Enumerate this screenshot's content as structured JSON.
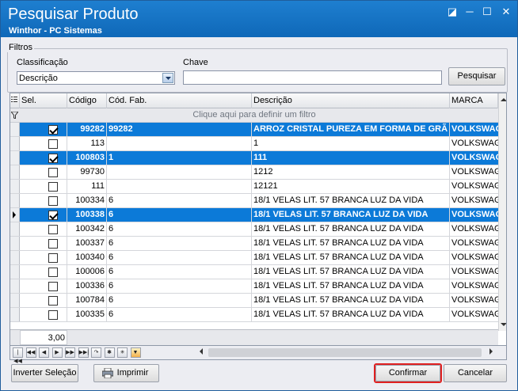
{
  "window": {
    "title": "Pesquisar Produto",
    "subtitle": "Winthor - PC Sistemas",
    "controls": {
      "help": "◪",
      "minimize": "─",
      "maximize": "☐",
      "close": "✕"
    }
  },
  "filters": {
    "group_label": "Filtros",
    "classificacao_label": "Classificação",
    "classificacao_value": "Descrição",
    "chave_label": "Chave",
    "chave_value": "",
    "search_button": "Pesquisar"
  },
  "grid": {
    "columns": [
      "Sel.",
      "Código",
      "Cód. Fab.",
      "Descrição",
      "MARCA"
    ],
    "filter_hint": "Clique aqui para definir um filtro",
    "rows": [
      {
        "selected": true,
        "checked": true,
        "codigo": "99282",
        "cod_fab": "99282",
        "descricao": "ARROZ  CRISTAL PUREZA EM FORMA DE GRÃ",
        "marca": "VOLKSWAG"
      },
      {
        "selected": false,
        "checked": false,
        "codigo": "113",
        "cod_fab": "",
        "descricao": "1",
        "marca": "VOLKSWAGI"
      },
      {
        "selected": true,
        "checked": true,
        "codigo": "100803",
        "cod_fab": "1",
        "descricao": "111",
        "marca": "VOLKSWAG"
      },
      {
        "selected": false,
        "checked": false,
        "codigo": "99730",
        "cod_fab": "",
        "descricao": "1212",
        "marca": "VOLKSWAGI"
      },
      {
        "selected": false,
        "checked": false,
        "codigo": "111",
        "cod_fab": "",
        "descricao": "12121",
        "marca": "VOLKSWAGI"
      },
      {
        "selected": false,
        "checked": false,
        "codigo": "100334",
        "cod_fab": "6",
        "descricao": "18/1 VELAS LIT. 57 BRANCA LUZ DA VIDA",
        "marca": "VOLKSWAGI"
      },
      {
        "selected": true,
        "checked": true,
        "current": true,
        "codigo": "100338",
        "cod_fab": "6",
        "descricao": "18/1 VELAS LIT. 57 BRANCA LUZ DA VIDA",
        "marca": "VOLKSWAG"
      },
      {
        "selected": false,
        "checked": false,
        "codigo": "100342",
        "cod_fab": "6",
        "descricao": "18/1 VELAS LIT. 57 BRANCA LUZ DA VIDA",
        "marca": "VOLKSWAGI"
      },
      {
        "selected": false,
        "checked": false,
        "codigo": "100337",
        "cod_fab": "6",
        "descricao": "18/1 VELAS LIT. 57 BRANCA LUZ DA VIDA",
        "marca": "VOLKSWAGI"
      },
      {
        "selected": false,
        "checked": false,
        "codigo": "100340",
        "cod_fab": "6",
        "descricao": "18/1 VELAS LIT. 57 BRANCA LUZ DA VIDA",
        "marca": "VOLKSWAGI"
      },
      {
        "selected": false,
        "checked": false,
        "codigo": "100006",
        "cod_fab": "6",
        "descricao": "18/1 VELAS LIT. 57 BRANCA LUZ DA VIDA",
        "marca": "VOLKSWAGI"
      },
      {
        "selected": false,
        "checked": false,
        "codigo": "100336",
        "cod_fab": "6",
        "descricao": "18/1 VELAS LIT. 57 BRANCA LUZ DA VIDA",
        "marca": "VOLKSWAGI"
      },
      {
        "selected": false,
        "checked": false,
        "codigo": "100784",
        "cod_fab": "6",
        "descricao": "18/1 VELAS LIT. 57 BRANCA LUZ DA VIDA",
        "marca": "VOLKSWAGI"
      },
      {
        "selected": false,
        "checked": false,
        "codigo": "100335",
        "cod_fab": "6",
        "descricao": "18/1 VELAS LIT. 57 BRANCA LUZ DA VIDA",
        "marca": "VOLKSWAGI"
      }
    ],
    "footer_total": "3,00"
  },
  "navigator": {
    "buttons": [
      "|◀◀",
      "◀◀",
      "◀",
      "▶",
      "▶▶",
      "▶▶|",
      "↷",
      "✱",
      "✳",
      "▼"
    ]
  },
  "actions": {
    "invert_selection": "Inverter Seleção",
    "print": "Imprimir",
    "confirm": "Confirmar",
    "cancel": "Cancelar"
  },
  "colors": {
    "title_bar": "#1477c8",
    "selected_row": "#0c7ad8",
    "confirm_highlight": "#e02020"
  }
}
